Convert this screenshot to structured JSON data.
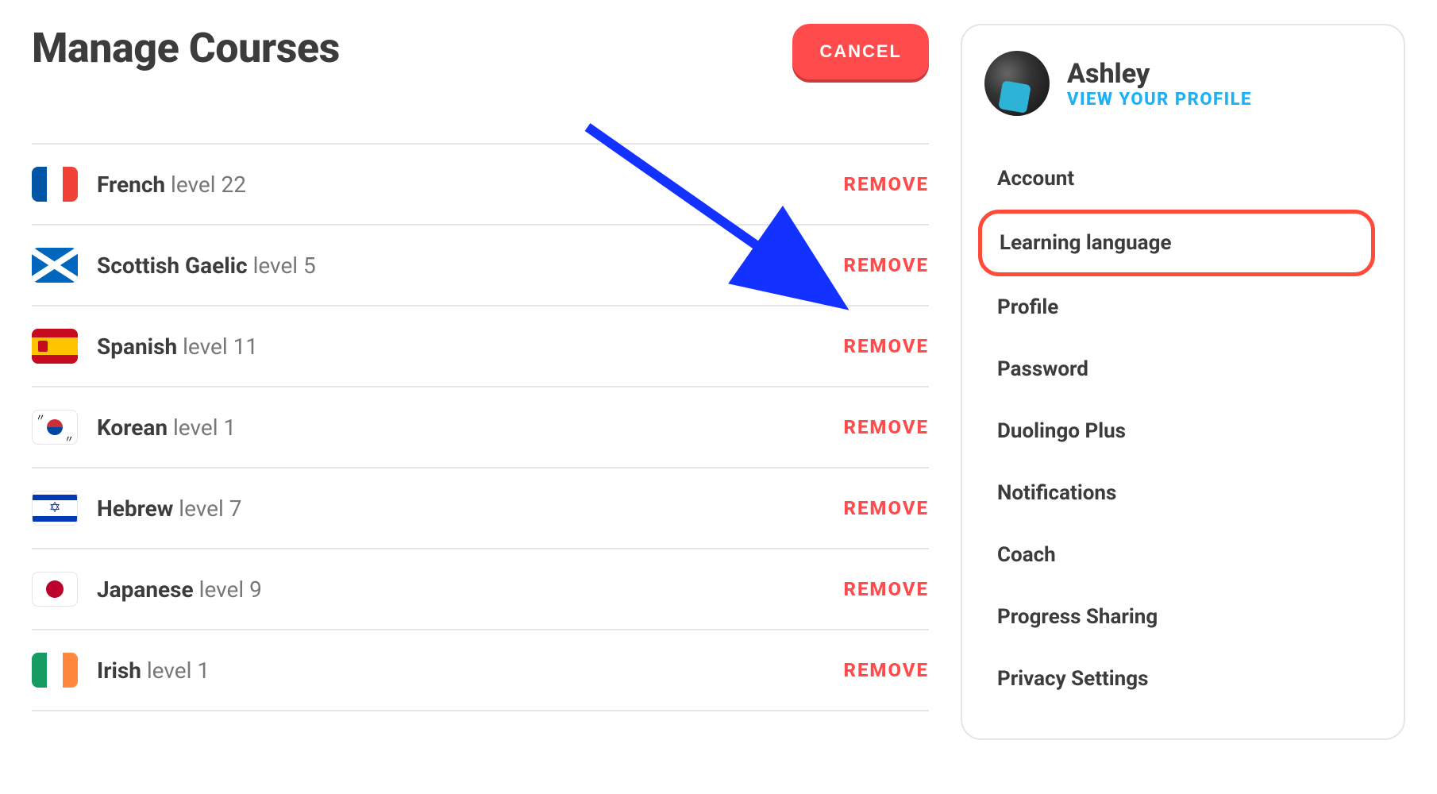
{
  "header": {
    "title": "Manage Courses",
    "cancel_label": "CANCEL"
  },
  "courses": [
    {
      "flag": "fr",
      "name": "French",
      "level_label": "level 22",
      "remove_label": "REMOVE"
    },
    {
      "flag": "sco",
      "name": "Scottish Gaelic",
      "level_label": "level 5",
      "remove_label": "REMOVE"
    },
    {
      "flag": "es",
      "name": "Spanish",
      "level_label": "level 11",
      "remove_label": "REMOVE"
    },
    {
      "flag": "kr",
      "name": "Korean",
      "level_label": "level 1",
      "remove_label": "REMOVE"
    },
    {
      "flag": "il",
      "name": "Hebrew",
      "level_label": "level 7",
      "remove_label": "REMOVE"
    },
    {
      "flag": "jp",
      "name": "Japanese",
      "level_label": "level 9",
      "remove_label": "REMOVE"
    },
    {
      "flag": "ie",
      "name": "Irish",
      "level_label": "level 1",
      "remove_label": "REMOVE"
    }
  ],
  "sidebar": {
    "profile_name": "Ashley",
    "profile_link": "VIEW YOUR PROFILE",
    "nav": [
      {
        "label": "Account",
        "highlighted": false
      },
      {
        "label": "Learning language",
        "highlighted": true
      },
      {
        "label": "Profile",
        "highlighted": false
      },
      {
        "label": "Password",
        "highlighted": false
      },
      {
        "label": "Duolingo Plus",
        "highlighted": false
      },
      {
        "label": "Notifications",
        "highlighted": false
      },
      {
        "label": "Coach",
        "highlighted": false
      },
      {
        "label": "Progress Sharing",
        "highlighted": false
      },
      {
        "label": "Privacy Settings",
        "highlighted": false
      }
    ]
  },
  "annotation": {
    "arrow_color": "#1432ff"
  }
}
